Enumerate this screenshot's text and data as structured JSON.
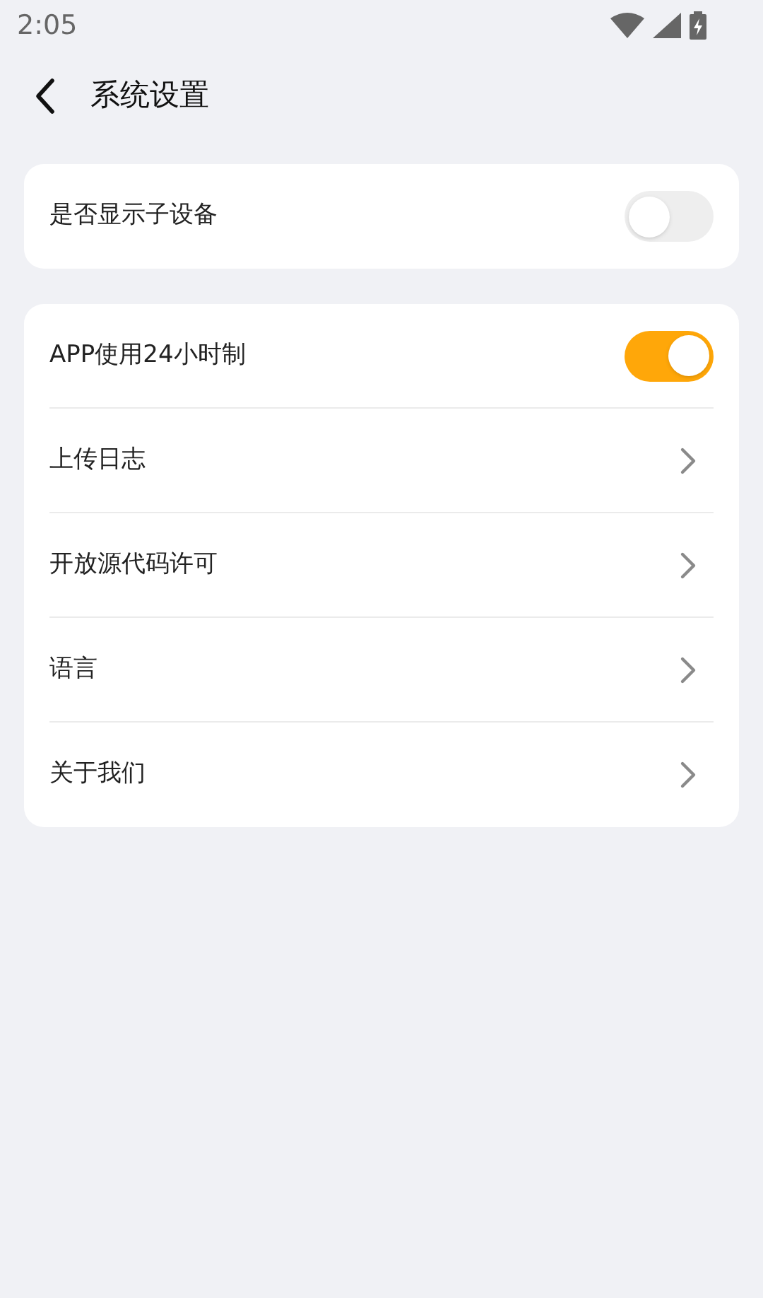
{
  "status_bar": {
    "time": "2:05"
  },
  "header": {
    "title": "系统设置"
  },
  "sections": [
    {
      "items": [
        {
          "kind": "toggle",
          "label": "是否显示子设备",
          "on": false
        }
      ]
    },
    {
      "items": [
        {
          "kind": "toggle",
          "label": "APP使用24小时制",
          "on": true
        },
        {
          "kind": "link",
          "label": "上传日志"
        },
        {
          "kind": "link",
          "label": "开放源代码许可"
        },
        {
          "kind": "link",
          "label": "语言"
        },
        {
          "kind": "link",
          "label": "关于我们"
        }
      ]
    }
  ]
}
